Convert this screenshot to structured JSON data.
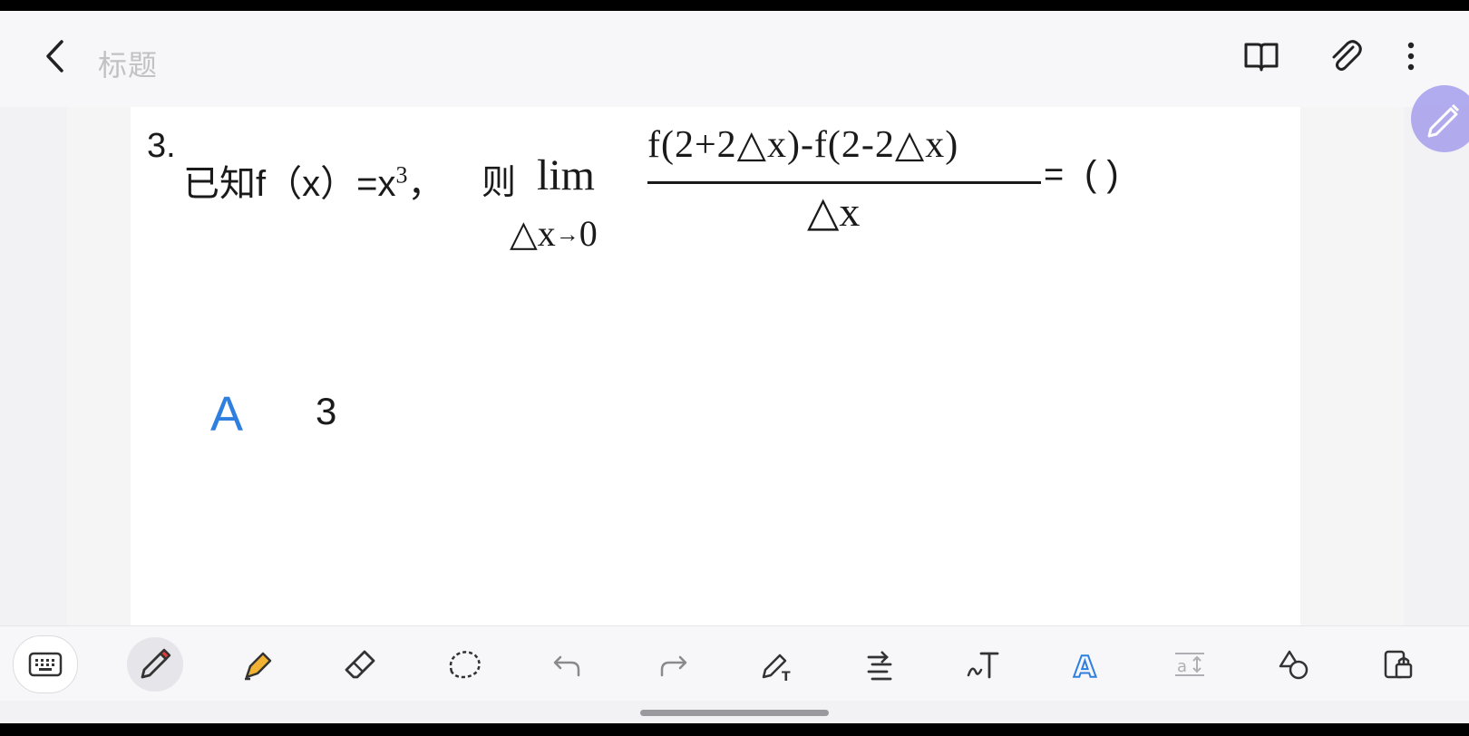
{
  "header": {
    "title": "标题",
    "icons": [
      "back-icon",
      "book-icon",
      "paperclip-icon",
      "more-vertical-icon"
    ]
  },
  "question": {
    "number": "3.",
    "intro": "已知f（x）=x",
    "exponent": "3",
    "comma": "，",
    "then": "则",
    "lim": "lim",
    "lim_var": "△x",
    "lim_arrow": "→",
    "lim_target": "0",
    "numerator": "f(2+2△x)-f(2-2△x)",
    "denominator": "△x",
    "equals": "=",
    "answer_blank": "(      )"
  },
  "option": {
    "letter": "A",
    "value": "3"
  },
  "toolbar": {
    "tools": [
      "keyboard-icon",
      "pen-icon",
      "highlighter-icon",
      "eraser-icon",
      "lasso-icon",
      "undo-icon",
      "redo-icon",
      "pen-to-text-icon",
      "format-icon",
      "handwriting-text-icon",
      "text-style-icon",
      "text-size-icon",
      "shapes-icon",
      "lock-icon"
    ],
    "active_tool": "pen-icon",
    "accent_color": "#2e7fe0",
    "pen_color": "#e33b3b",
    "highlighter_color": "#f2b233"
  }
}
